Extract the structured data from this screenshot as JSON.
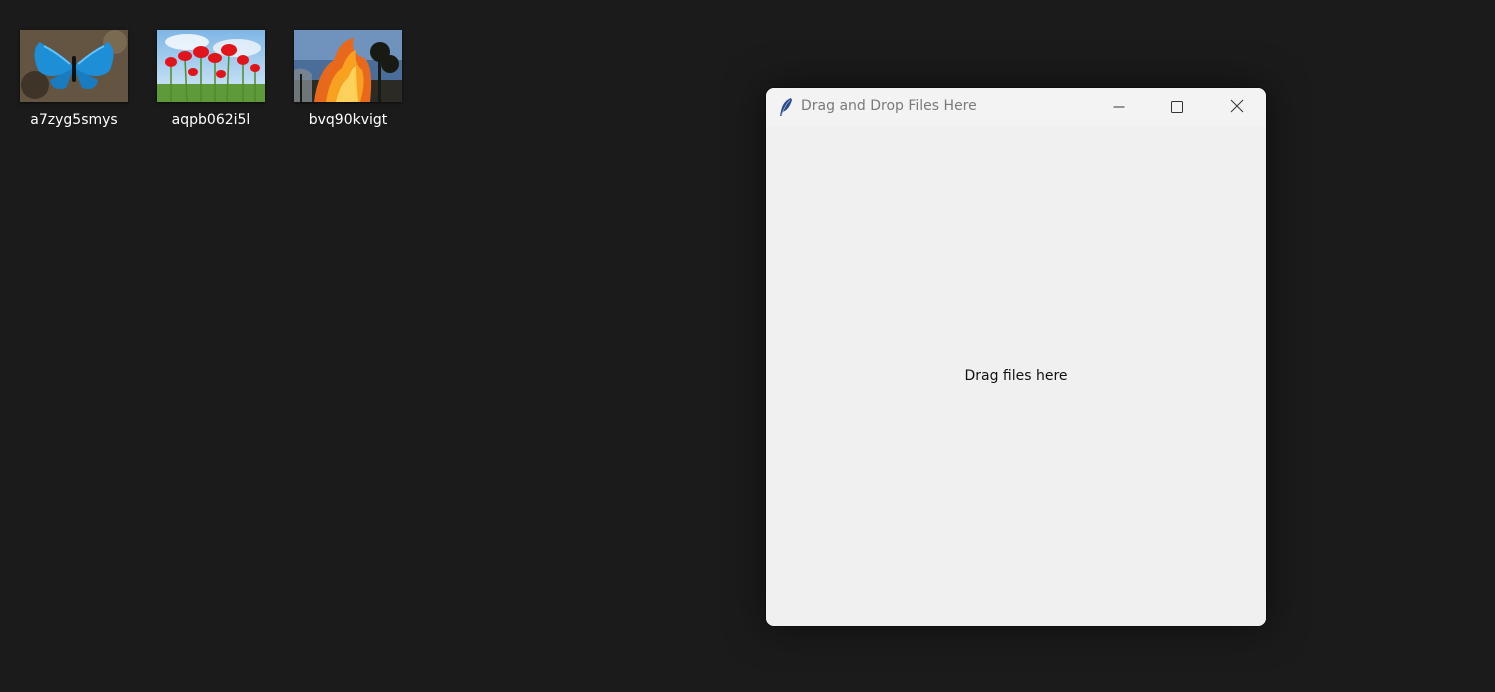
{
  "desktop": {
    "background": "#1b1b1b",
    "icons": [
      {
        "label": "a7zyg5smys",
        "image": "blue-butterfly-photo"
      },
      {
        "label": "aqpb062i5l",
        "image": "red-poppies-photo"
      },
      {
        "label": "bvq90kvigt",
        "image": "wildfire-photo"
      }
    ]
  },
  "window": {
    "title": "Drag and Drop Files Here",
    "app_icon": "feather-icon",
    "controls": {
      "minimize": "minimize-icon",
      "maximize": "maximize-icon",
      "close": "close-icon"
    },
    "drop_label": "Drag files here",
    "background": "#f0f0f0"
  }
}
